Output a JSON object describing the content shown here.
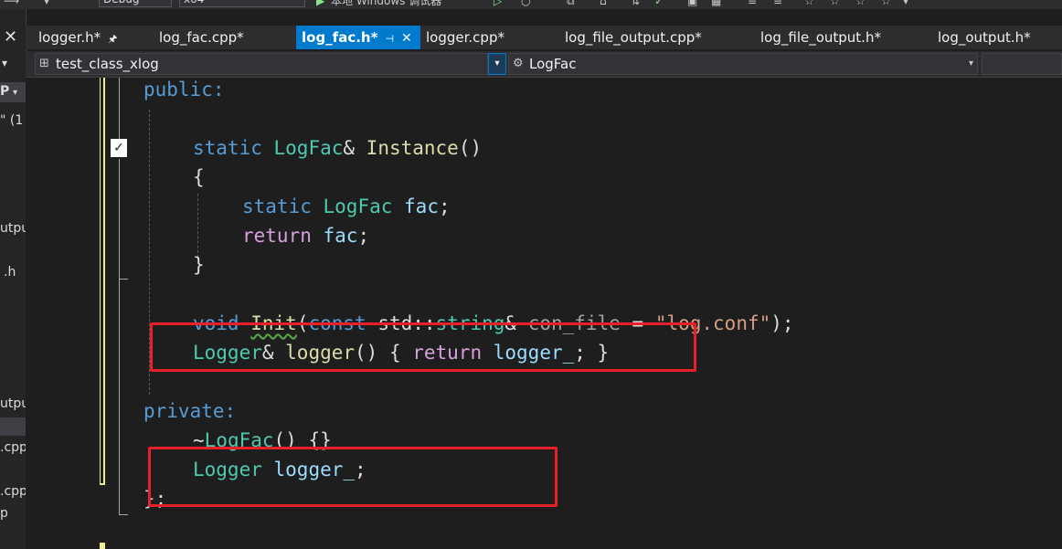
{
  "toolbar": {
    "config": "Debug",
    "platform": "x64",
    "debugger": "本地 Windows 调试器"
  },
  "left_panel": {
    "items": [
      "P",
      "\" (1",
      "utpu",
      ".h",
      "utpu",
      ".cpp",
      ".cpp",
      "p"
    ]
  },
  "tabs": [
    {
      "label": "logger.h*",
      "pinned": true
    },
    {
      "label": "log_fac.cpp*"
    },
    {
      "label": "log_fac.h*",
      "active": true,
      "pinned": true
    },
    {
      "label": "logger.cpp*"
    },
    {
      "label": "log_file_output.cpp*"
    },
    {
      "label": "log_file_output.h*"
    },
    {
      "label": "log_output.h*"
    }
  ],
  "navbar": {
    "scope": "test_class_xlog",
    "member": "LogFac"
  },
  "code": {
    "l1": "public:",
    "l3_kw": "static",
    "l3_type": "LogFac",
    "l3_amp": "& ",
    "l3_fn": "Instance",
    "l3_paren": "()",
    "l4": "{",
    "l5_kw": "static",
    "l5_type": "LogFac",
    "l5_var": "fac",
    "l5_semi": ";",
    "l6_kw": "return",
    "l6_var": "fac",
    "l6_semi": ";",
    "l7": "}",
    "l9_kw": "void",
    "l9_fn": "Init",
    "l9_rest_open": "(",
    "l9_const": "const",
    "l9_ns": "std::",
    "l9_type": "string",
    "l9_amp": "& ",
    "l9_param": "con_file",
    "l9_eq": " = ",
    "l9_str": "\"log.conf\"",
    "l9_end": ");",
    "l10_type": "Logger",
    "l10_amp": "& ",
    "l10_fn": "logger",
    "l10_mid": "() { ",
    "l10_kw": "return",
    "l10_var": "logger_",
    "l10_end": "; }",
    "l12": "private:",
    "l13_tilde": "~",
    "l13_type": "LogFac",
    "l13_rest": "() {}",
    "l14_type": "Logger",
    "l14_var": "logger_",
    "l14_semi": ";",
    "l15": "};"
  }
}
